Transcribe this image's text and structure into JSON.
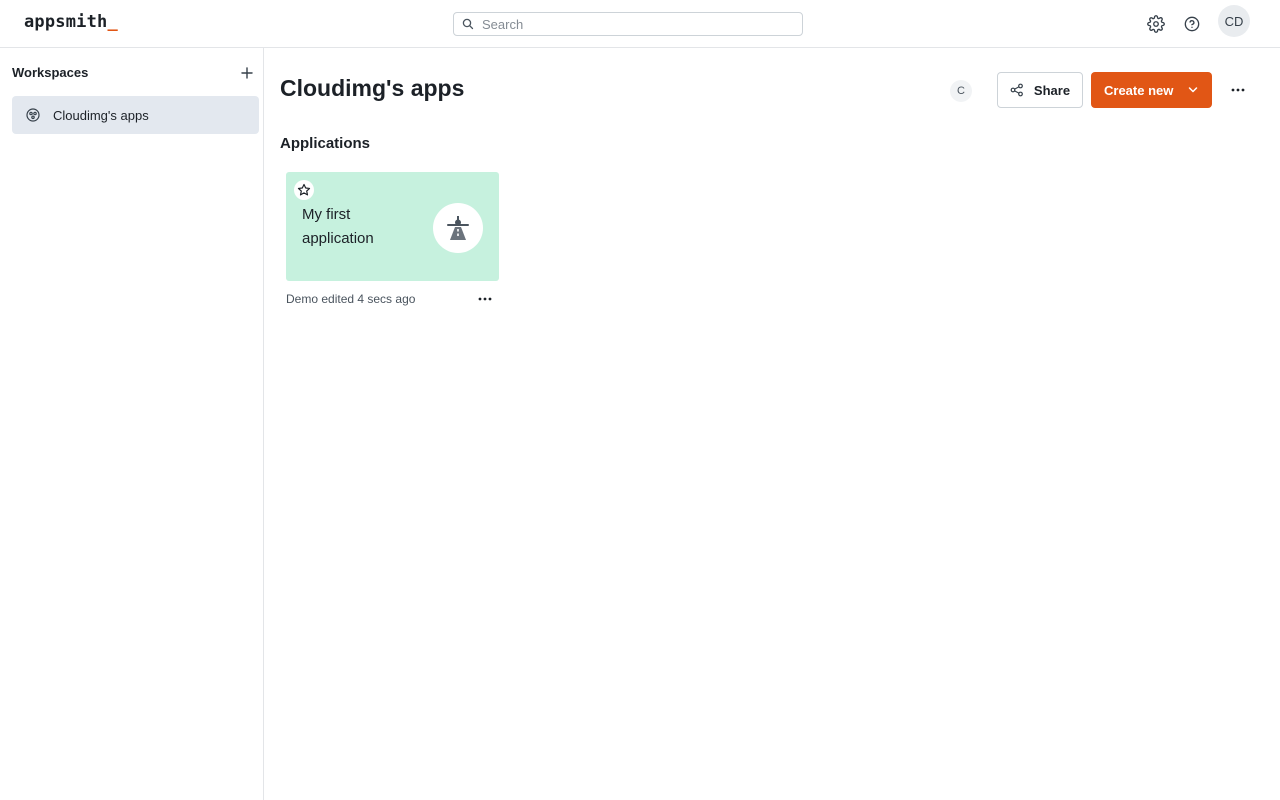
{
  "header": {
    "logo_text": "appsmith",
    "logo_cursor": "_",
    "search_placeholder": "Search",
    "icons": [
      "search-icon",
      "gear-icon",
      "help-icon"
    ],
    "avatar_initials": "CD"
  },
  "sidebar": {
    "title": "Workspaces",
    "add_icon": "plus-icon",
    "items": [
      {
        "label": "Cloudimg's apps",
        "icon": "workspace-icon",
        "selected": true
      }
    ]
  },
  "main": {
    "title": "Cloudimg's apps",
    "member_initial": "C",
    "share_label": "Share",
    "create_label": "Create new",
    "section_title": "Applications",
    "apps": [
      {
        "name": "My first application",
        "meta": "Demo edited 4 secs ago",
        "icon": "airplane-icon",
        "card_color": "#c6f1de"
      }
    ]
  },
  "colors": {
    "accent": "#e15615",
    "selected_bg": "#e3e8ef",
    "card_bg": "#c6f1de"
  }
}
